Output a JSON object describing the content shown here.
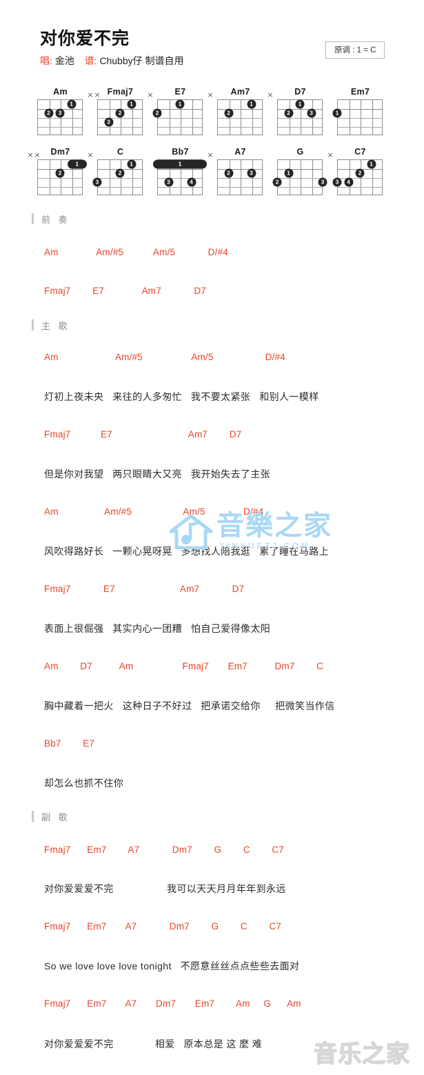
{
  "header": {
    "title": "对你爱不完",
    "singer_label": "唱:",
    "singer": "金池",
    "arranger_label": "谱:",
    "arranger": "Chubby仔 制谱自用",
    "key_box": "原调 : 1 = C"
  },
  "chord_diagrams": [
    {
      "name": "Am",
      "strings": 5,
      "frets": 4,
      "muted": [],
      "dots": [
        {
          "string": 2,
          "fret": 1,
          "finger": "1"
        },
        {
          "string": 4,
          "fret": 2,
          "finger": "2"
        },
        {
          "string": 3,
          "fret": 2,
          "finger": "3"
        }
      ],
      "barres": []
    },
    {
      "name": "Fmaj7",
      "strings": 5,
      "frets": 4,
      "muted": [
        6,
        5
      ],
      "dots": [
        {
          "string": 2,
          "fret": 1,
          "finger": "1"
        },
        {
          "string": 3,
          "fret": 2,
          "finger": "2"
        },
        {
          "string": 4,
          "fret": 3,
          "finger": "3"
        }
      ],
      "barres": []
    },
    {
      "name": "E7",
      "strings": 5,
      "frets": 4,
      "muted": [
        6
      ],
      "dots": [
        {
          "string": 3,
          "fret": 1,
          "finger": "1"
        },
        {
          "string": 5,
          "fret": 2,
          "finger": "2"
        }
      ],
      "barres": []
    },
    {
      "name": "Am7",
      "strings": 5,
      "frets": 4,
      "muted": [
        6
      ],
      "dots": [
        {
          "string": 2,
          "fret": 1,
          "finger": "1"
        },
        {
          "string": 4,
          "fret": 2,
          "finger": "2"
        }
      ],
      "barres": []
    },
    {
      "name": "D7",
      "strings": 5,
      "frets": 4,
      "muted": [
        6
      ],
      "dots": [
        {
          "string": 3,
          "fret": 1,
          "finger": "1"
        },
        {
          "string": 4,
          "fret": 2,
          "finger": "2"
        },
        {
          "string": 2,
          "fret": 2,
          "finger": "3"
        }
      ],
      "barres": []
    },
    {
      "name": "Em7",
      "strings": 5,
      "frets": 4,
      "muted": [],
      "dots": [
        {
          "string": 5,
          "fret": 2,
          "finger": "1"
        }
      ],
      "barres": []
    },
    {
      "name": "Dm7",
      "strings": 5,
      "frets": 4,
      "muted": [
        6,
        5
      ],
      "dots": [
        {
          "string": 3,
          "fret": 2,
          "finger": "2"
        }
      ],
      "barres": [
        {
          "fret": 1,
          "from": 2,
          "to": 1,
          "finger": "1"
        }
      ]
    },
    {
      "name": "C",
      "strings": 5,
      "frets": 4,
      "muted": [
        6
      ],
      "dots": [
        {
          "string": 2,
          "fret": 1,
          "finger": "1"
        },
        {
          "string": 3,
          "fret": 2,
          "finger": "2"
        },
        {
          "string": 5,
          "fret": 3,
          "finger": "3"
        }
      ],
      "barres": []
    },
    {
      "name": "Bb7",
      "strings": 5,
      "frets": 4,
      "muted": [],
      "dots": [
        {
          "string": 4,
          "fret": 3,
          "finger": "3"
        },
        {
          "string": 2,
          "fret": 3,
          "finger": "4"
        }
      ],
      "barres": [
        {
          "fret": 1,
          "from": 5,
          "to": 1,
          "finger": "1"
        }
      ]
    },
    {
      "name": "A7",
      "strings": 5,
      "frets": 4,
      "muted": [
        6
      ],
      "dots": [
        {
          "string": 4,
          "fret": 2,
          "finger": "2"
        },
        {
          "string": 2,
          "fret": 2,
          "finger": "3"
        }
      ],
      "barres": []
    },
    {
      "name": "G",
      "strings": 5,
      "frets": 4,
      "muted": [],
      "dots": [
        {
          "string": 4,
          "fret": 2,
          "finger": "1"
        },
        {
          "string": 5,
          "fret": 3,
          "finger": "2"
        },
        {
          "string": 1,
          "fret": 3,
          "finger": "3"
        }
      ],
      "barres": []
    },
    {
      "name": "C7",
      "strings": 5,
      "frets": 4,
      "muted": [
        6
      ],
      "dots": [
        {
          "string": 2,
          "fret": 1,
          "finger": "1"
        },
        {
          "string": 3,
          "fret": 2,
          "finger": "2"
        },
        {
          "string": 5,
          "fret": 3,
          "finger": "3"
        },
        {
          "string": 4,
          "fret": 3,
          "finger": "4"
        }
      ],
      "barres": []
    }
  ],
  "sections": [
    {
      "heading": "前 奏",
      "lines": [
        {
          "chords": "Am              Am/#5           Am/5            D/#4"
        },
        {
          "chords": "Fmaj7        E7              Am7            D7"
        }
      ]
    },
    {
      "heading": "主 歌",
      "lines": [
        {
          "chords": "Am                     Am/#5                  Am/5                   D/#4",
          "lyrics": "灯初上夜未央   来往的人多匆忙   我不要太紧张   和别人一模样"
        },
        {
          "chords": "Fmaj7           E7                            Am7        D7",
          "lyrics": "但是你对我望   两只眼睛大又亮   我开始失去了主张"
        },
        {
          "chords": "Am                 Am/#5                   Am/5              D/#4",
          "lyrics": "风吹得路好长   一颗心晃呀晃   多想找人陪我逛   累了睡在马路上"
        },
        {
          "chords": "Fmaj7            E7                        Am7            D7",
          "lyrics": "表面上很倔强   其实内心一团糟   怕自己爱得像太阳"
        },
        {
          "chords": "Am        D7          Am                  Fmaj7       Em7          Dm7        C",
          "lyrics": "胸中藏着一把火   这种日子不好过   把承诺交给你     把微笑当作信"
        },
        {
          "chords": "Bb7        E7",
          "lyrics": "却怎么也抓不住你"
        }
      ]
    },
    {
      "heading": "副 歌",
      "lines": [
        {
          "chords": "Fmaj7      Em7        A7            Dm7        G        C        C7",
          "lyrics": "对你爱爱爱不完                  我可以天天月月年年到永远"
        },
        {
          "chords": "Fmaj7      Em7       A7            Dm7        G        C        C7",
          "lyrics": "So we love love love tonight   不愿意丝丝点点些些去面对"
        },
        {
          "chords": "Fmaj7      Em7       A7       Dm7       Em7        Am     G      Am",
          "lyrics": "对你爱爱爱不完              相爱   原本总是 这 麼 难"
        }
      ]
    }
  ],
  "watermarks": {
    "main_text": "音樂之家",
    "main_sub": "YINYUEZJ.COM",
    "bottom_text": "音乐之家"
  },
  "colors": {
    "chord": "#e8442a",
    "lyric": "#2b2b2b",
    "section": "#8d8d8d",
    "watermark": "#a8d8f5"
  }
}
